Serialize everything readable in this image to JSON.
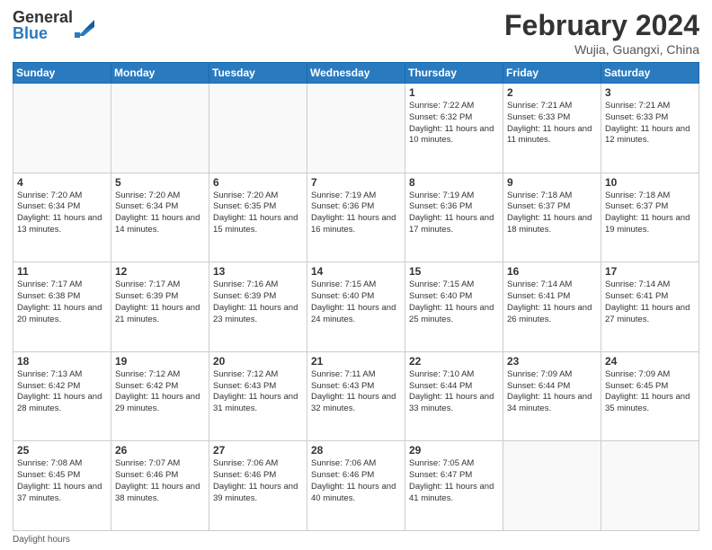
{
  "logo": {
    "general": "General",
    "blue": "Blue"
  },
  "header": {
    "month": "February 2024",
    "location": "Wujia, Guangxi, China"
  },
  "days": [
    "Sunday",
    "Monday",
    "Tuesday",
    "Wednesday",
    "Thursday",
    "Friday",
    "Saturday"
  ],
  "weeks": [
    [
      {
        "num": "",
        "info": ""
      },
      {
        "num": "",
        "info": ""
      },
      {
        "num": "",
        "info": ""
      },
      {
        "num": "",
        "info": ""
      },
      {
        "num": "1",
        "info": "Sunrise: 7:22 AM\nSunset: 6:32 PM\nDaylight: 11 hours\nand 10 minutes."
      },
      {
        "num": "2",
        "info": "Sunrise: 7:21 AM\nSunset: 6:33 PM\nDaylight: 11 hours\nand 11 minutes."
      },
      {
        "num": "3",
        "info": "Sunrise: 7:21 AM\nSunset: 6:33 PM\nDaylight: 11 hours\nand 12 minutes."
      }
    ],
    [
      {
        "num": "4",
        "info": "Sunrise: 7:20 AM\nSunset: 6:34 PM\nDaylight: 11 hours\nand 13 minutes."
      },
      {
        "num": "5",
        "info": "Sunrise: 7:20 AM\nSunset: 6:34 PM\nDaylight: 11 hours\nand 14 minutes."
      },
      {
        "num": "6",
        "info": "Sunrise: 7:20 AM\nSunset: 6:35 PM\nDaylight: 11 hours\nand 15 minutes."
      },
      {
        "num": "7",
        "info": "Sunrise: 7:19 AM\nSunset: 6:36 PM\nDaylight: 11 hours\nand 16 minutes."
      },
      {
        "num": "8",
        "info": "Sunrise: 7:19 AM\nSunset: 6:36 PM\nDaylight: 11 hours\nand 17 minutes."
      },
      {
        "num": "9",
        "info": "Sunrise: 7:18 AM\nSunset: 6:37 PM\nDaylight: 11 hours\nand 18 minutes."
      },
      {
        "num": "10",
        "info": "Sunrise: 7:18 AM\nSunset: 6:37 PM\nDaylight: 11 hours\nand 19 minutes."
      }
    ],
    [
      {
        "num": "11",
        "info": "Sunrise: 7:17 AM\nSunset: 6:38 PM\nDaylight: 11 hours\nand 20 minutes."
      },
      {
        "num": "12",
        "info": "Sunrise: 7:17 AM\nSunset: 6:39 PM\nDaylight: 11 hours\nand 21 minutes."
      },
      {
        "num": "13",
        "info": "Sunrise: 7:16 AM\nSunset: 6:39 PM\nDaylight: 11 hours\nand 23 minutes."
      },
      {
        "num": "14",
        "info": "Sunrise: 7:15 AM\nSunset: 6:40 PM\nDaylight: 11 hours\nand 24 minutes."
      },
      {
        "num": "15",
        "info": "Sunrise: 7:15 AM\nSunset: 6:40 PM\nDaylight: 11 hours\nand 25 minutes."
      },
      {
        "num": "16",
        "info": "Sunrise: 7:14 AM\nSunset: 6:41 PM\nDaylight: 11 hours\nand 26 minutes."
      },
      {
        "num": "17",
        "info": "Sunrise: 7:14 AM\nSunset: 6:41 PM\nDaylight: 11 hours\nand 27 minutes."
      }
    ],
    [
      {
        "num": "18",
        "info": "Sunrise: 7:13 AM\nSunset: 6:42 PM\nDaylight: 11 hours\nand 28 minutes."
      },
      {
        "num": "19",
        "info": "Sunrise: 7:12 AM\nSunset: 6:42 PM\nDaylight: 11 hours\nand 29 minutes."
      },
      {
        "num": "20",
        "info": "Sunrise: 7:12 AM\nSunset: 6:43 PM\nDaylight: 11 hours\nand 31 minutes."
      },
      {
        "num": "21",
        "info": "Sunrise: 7:11 AM\nSunset: 6:43 PM\nDaylight: 11 hours\nand 32 minutes."
      },
      {
        "num": "22",
        "info": "Sunrise: 7:10 AM\nSunset: 6:44 PM\nDaylight: 11 hours\nand 33 minutes."
      },
      {
        "num": "23",
        "info": "Sunrise: 7:09 AM\nSunset: 6:44 PM\nDaylight: 11 hours\nand 34 minutes."
      },
      {
        "num": "24",
        "info": "Sunrise: 7:09 AM\nSunset: 6:45 PM\nDaylight: 11 hours\nand 35 minutes."
      }
    ],
    [
      {
        "num": "25",
        "info": "Sunrise: 7:08 AM\nSunset: 6:45 PM\nDaylight: 11 hours\nand 37 minutes."
      },
      {
        "num": "26",
        "info": "Sunrise: 7:07 AM\nSunset: 6:46 PM\nDaylight: 11 hours\nand 38 minutes."
      },
      {
        "num": "27",
        "info": "Sunrise: 7:06 AM\nSunset: 6:46 PM\nDaylight: 11 hours\nand 39 minutes."
      },
      {
        "num": "28",
        "info": "Sunrise: 7:06 AM\nSunset: 6:46 PM\nDaylight: 11 hours\nand 40 minutes."
      },
      {
        "num": "29",
        "info": "Sunrise: 7:05 AM\nSunset: 6:47 PM\nDaylight: 11 hours\nand 41 minutes."
      },
      {
        "num": "",
        "info": ""
      },
      {
        "num": "",
        "info": ""
      }
    ]
  ],
  "footer": {
    "note": "Daylight hours"
  }
}
